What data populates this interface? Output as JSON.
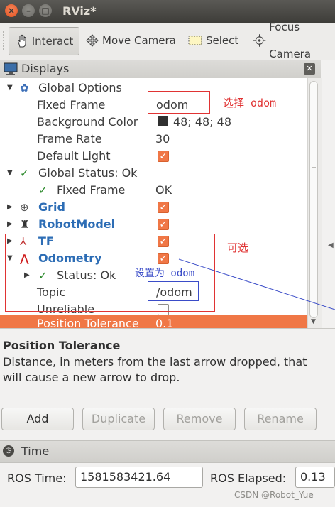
{
  "window": {
    "title": "RViz*"
  },
  "toolbar": {
    "tools": [
      {
        "label": "Interact",
        "icon": "hand-icon",
        "active": true
      },
      {
        "label": "Move Camera",
        "icon": "move-camera-icon",
        "active": false
      },
      {
        "label": "Select",
        "icon": "select-icon",
        "active": false
      },
      {
        "label": "Focus Camera",
        "icon": "focus-icon",
        "active": false
      }
    ]
  },
  "displays": {
    "title": "Displays",
    "rows": {
      "global_options": "Global Options",
      "fixed_frame": {
        "name": "Fixed Frame",
        "value": "odom"
      },
      "background_color": {
        "name": "Background Color",
        "value": "48; 48; 48"
      },
      "frame_rate": {
        "name": "Frame Rate",
        "value": "30"
      },
      "default_light": {
        "name": "Default Light",
        "checked": true
      },
      "global_status": "Global Status: Ok",
      "status_fixed_frame": {
        "name": "Fixed Frame",
        "value": "OK"
      },
      "grid": {
        "name": "Grid",
        "checked": true
      },
      "robot_model": {
        "name": "RobotModel",
        "checked": true
      },
      "tf": {
        "name": "TF",
        "checked": true
      },
      "odometry": {
        "name": "Odometry",
        "checked": true
      },
      "odom_status": "Status: Ok",
      "topic": {
        "name": "Topic",
        "value": "/odom"
      },
      "unreliable": {
        "name": "Unreliable",
        "checked": false
      },
      "position_tolerance": {
        "name": "Position Tolerance",
        "value": "0.1"
      }
    },
    "annotations": {
      "select_odom": "选择 odom",
      "optional": "可选",
      "set_to_odom": "设置为 odom"
    }
  },
  "description": {
    "title": "Position Tolerance",
    "text": "Distance, in meters from the last arrow dropped, that will cause a new arrow to drop."
  },
  "buttons": {
    "add": "Add",
    "duplicate": "Duplicate",
    "remove": "Remove",
    "rename": "Rename"
  },
  "time": {
    "title": "Time",
    "ros_time_label": "ROS Time:",
    "ros_time": "1581583421.64",
    "ros_elapsed_label": "ROS Elapsed:",
    "ros_elapsed": "0.13"
  },
  "watermark": "CSDN @Robot_Yue",
  "colors": {
    "accent": "#f07746",
    "link": "#2d6db5",
    "annotation_red": "#e03333",
    "annotation_blue": "#3a4cc8"
  }
}
